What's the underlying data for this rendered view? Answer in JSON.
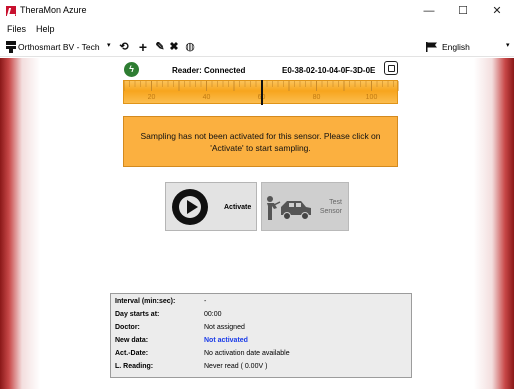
{
  "window": {
    "title": "TheraMon Azure",
    "minimize": "—",
    "maximize": "☐",
    "close": "✕"
  },
  "menu": [
    "Files",
    "Help"
  ],
  "toolbar": {
    "organization": "Orthosmart BV - Tech",
    "language": "English"
  },
  "reader": {
    "status": "Reader: Connected",
    "id": "E0-38-02-10-04-0F-3D-0E"
  },
  "gauge": {
    "labels": [
      "20",
      "40",
      "60",
      "80",
      "100"
    ],
    "min": 10,
    "max": 110,
    "needle_value": 60
  },
  "notice": {
    "text": "Sampling has not been activated for this sensor. Please click on 'Activate' to start sampling."
  },
  "actions": {
    "activate_label": "Activate",
    "test_label_line1": "Test",
    "test_label_line2": "Sensor"
  },
  "info": {
    "rows": [
      {
        "label": "Interval (min:sec):",
        "value": "-"
      },
      {
        "label": "Day starts at:",
        "value": "00:00"
      },
      {
        "label": "Doctor:",
        "value": "Not assigned"
      },
      {
        "label": "New data:",
        "value": "Not activated"
      },
      {
        "label": "Act.-Date:",
        "value": "No activation date available"
      },
      {
        "label": "L. Reading:",
        "value": "Never read ( 0.00V )"
      }
    ],
    "accent_color": "#1a3be8"
  },
  "colors": {
    "gauge": "#f7a51d",
    "notice": "#fbb040",
    "border_red": "#8a1818",
    "status_green": "#2e7d32"
  }
}
